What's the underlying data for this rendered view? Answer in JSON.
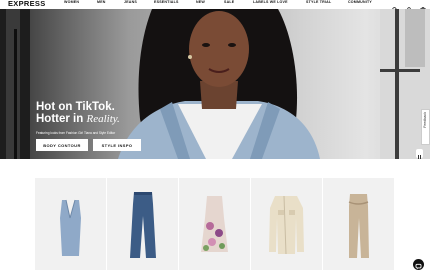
{
  "brand": "EXPRESS",
  "nav": {
    "items": [
      "WOMEN",
      "MEN",
      "JEANS",
      "ESSENTIALS",
      "NEW",
      "SALE",
      "LABELS WE LOVE",
      "STYLE TRIAL",
      "COMMUNITY"
    ],
    "icons": [
      "search-icon",
      "user-icon",
      "bag-icon"
    ]
  },
  "hero": {
    "title_line1": "Hot on TikTok.",
    "title_line2_prefix": "Hotter in ",
    "title_line2_em": "Reality.",
    "subtitle": "Featuring looks from Fashion Girl Tiana and Style Editor",
    "buttons": [
      "BODY CONTOUR",
      "STYLE INSPO"
    ],
    "feedback_label": "Feedback"
  },
  "products": [
    {
      "name": "blue-knit-tank"
    },
    {
      "name": "flare-jeans"
    },
    {
      "name": "floral-dress"
    },
    {
      "name": "cream-jacket"
    },
    {
      "name": "khaki-pants"
    }
  ],
  "colors": {
    "nav_text": "#111111",
    "hero_text": "#ffffff",
    "card_bg": "#f1f1f1"
  }
}
